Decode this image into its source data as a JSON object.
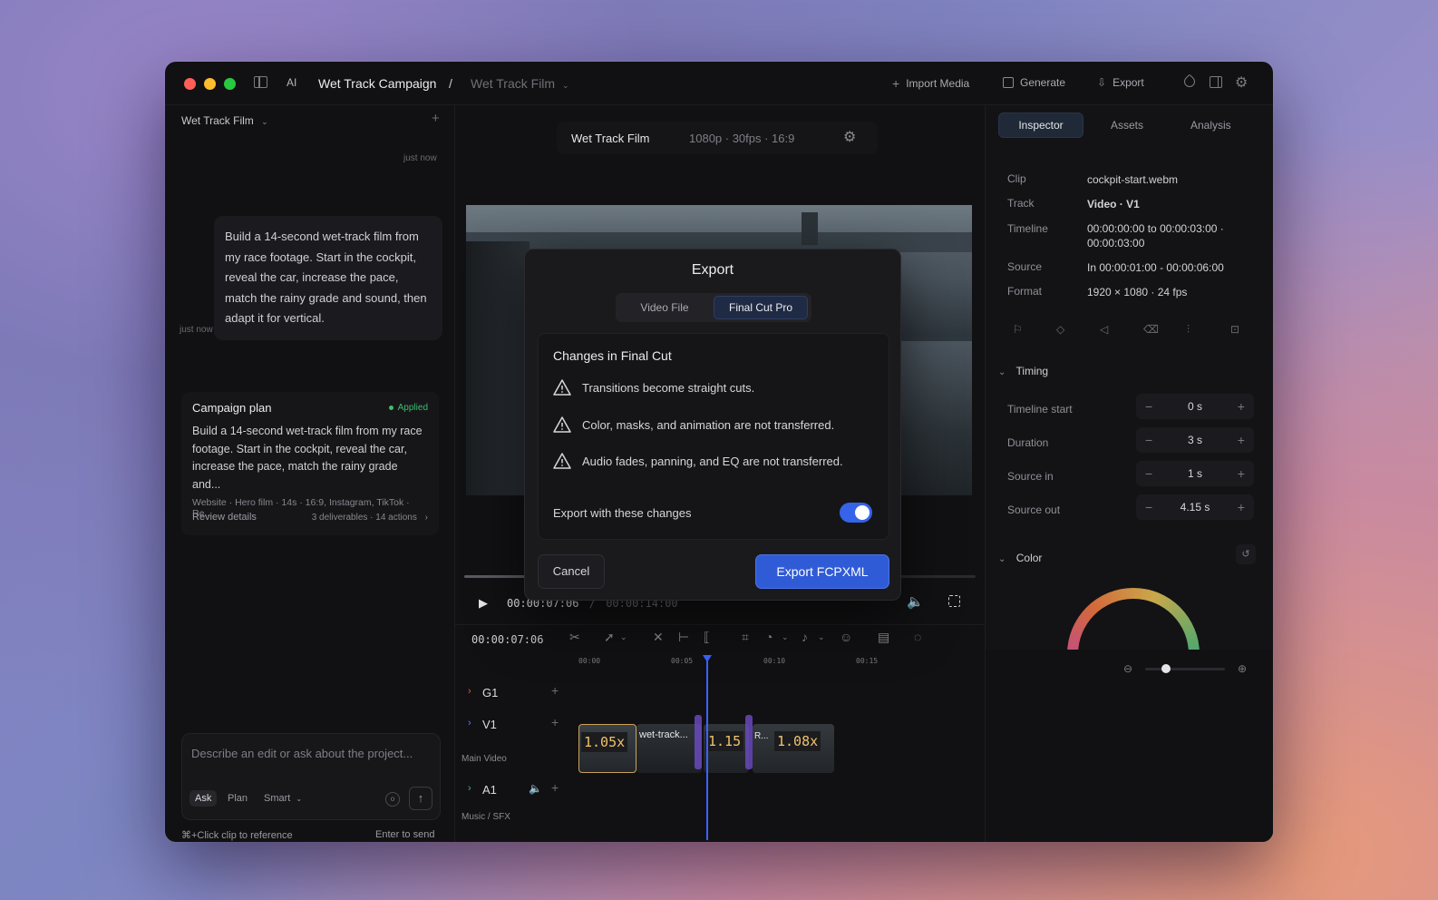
{
  "titlebar": {
    "ai_label": "AI",
    "project": "Wet Track Campaign",
    "separator": "/",
    "film": "Wet Track Film",
    "import_media": "Import Media",
    "generate": "Generate",
    "export": "Export"
  },
  "left": {
    "selector": "Wet Track Film",
    "user_time": "just now",
    "user_message": "Build a 14-second wet-track film from my race footage. Start in the cockpit, reveal the car, increase the pace, match the rainy grade and sound, then adapt it for vertical.",
    "ai_time": "just now",
    "card": {
      "title": "Campaign plan",
      "status": "Applied",
      "body": "Build a 14-second wet-track film from my race footage. Start in the cockpit, reveal the car, increase the pace, match the rainy grade and...",
      "meta": "Website · Hero film · 14s · 16:9, Instagram, TikTok · Re...",
      "review": "Review details",
      "summary": "3 deliverables · 14 actions"
    },
    "composer": {
      "placeholder": "Describe an edit or ask about the project...",
      "modes": [
        "Ask",
        "Plan",
        "Smart"
      ],
      "hint_left": "⌘+Click clip to reference",
      "hint_right": "Enter to send"
    }
  },
  "center": {
    "film_name": "Wet Track Film",
    "format": "1080p · 30fps · 16:9",
    "playhead": "00:00:07:06",
    "separator": "/",
    "duration": "00:00:14:00",
    "timecode": "00:00:07:06",
    "ruler": [
      "00:00",
      "00:05",
      "00:10",
      "00:15"
    ],
    "tracks": {
      "g1": "G1",
      "v1": "V1",
      "v1_sub": "Main Video",
      "a1": "A1",
      "a1_sub": "Music / SFX"
    },
    "clips": {
      "c1_speed": "1.05x",
      "c2_name": "wet-track...",
      "c3_speed": "1.15",
      "c4_name": "R...",
      "c4_speed": "1.08x"
    }
  },
  "inspector": {
    "tabs": [
      "Inspector",
      "Assets",
      "Analysis"
    ],
    "rows": {
      "clip_l": "Clip",
      "clip_v": "cockpit-start.webm",
      "track_l": "Track",
      "track_v": "Video · V1",
      "timeline_l": "Timeline",
      "timeline_v": "00:00:00:00 to 00:00:03:00 · 00:00:03:00",
      "source_l": "Source",
      "source_v": "In 00:00:01:00 - 00:00:06:00",
      "format_l": "Format",
      "format_v": "1920 × 1080 · 24 fps"
    },
    "timing": {
      "header": "Timing",
      "start_l": "Timeline start",
      "start_v": "0 s",
      "duration_l": "Duration",
      "duration_v": "3 s",
      "in_l": "Source in",
      "in_v": "1 s",
      "out_l": "Source out",
      "out_v": "4.15 s"
    },
    "color_header": "Color"
  },
  "modal": {
    "title": "Export",
    "tabs": [
      "Video File",
      "Final Cut Pro"
    ],
    "changes_title": "Changes in Final Cut",
    "changes": [
      "Transitions become straight cuts.",
      "Color, masks, and animation are not transferred.",
      "Audio fades, panning, and EQ are not transferred."
    ],
    "toggle_label": "Export with these changes",
    "toggle_on": true,
    "cancel": "Cancel",
    "confirm": "Export FCPXML"
  },
  "colors": {
    "accent": "#2f5bd6",
    "applied": "#3ebd6b",
    "playhead": "#3b63ff"
  }
}
